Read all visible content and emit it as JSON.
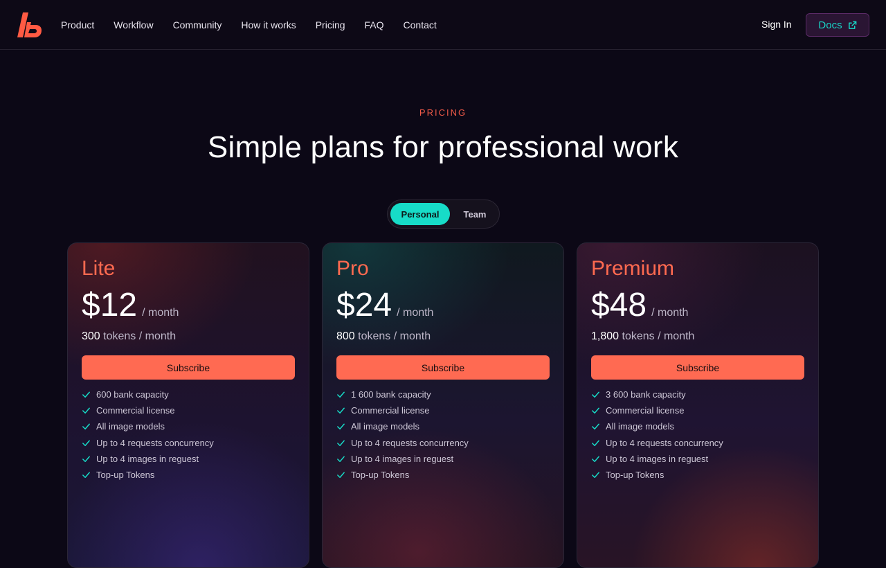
{
  "nav": {
    "links": [
      "Product",
      "Workflow",
      "Community",
      "How it works",
      "Pricing",
      "FAQ",
      "Contact"
    ],
    "sign_in": "Sign In",
    "docs": "Docs"
  },
  "hero": {
    "eyebrow": "PRICING",
    "title": "Simple plans for professional work"
  },
  "toggle": {
    "options": [
      "Personal",
      "Team"
    ],
    "selected": "Personal"
  },
  "plans": [
    {
      "name": "Lite",
      "price": "$12",
      "per": "/ month",
      "tokens": "300",
      "tokens_suffix": "tokens / month",
      "cta": "Subscribe",
      "features": [
        "600 bank capacity",
        "Commercial license",
        "All image models",
        "Up to 4 requests concurrency",
        "Up to 4 images in reguest",
        "Top-up Tokens"
      ]
    },
    {
      "name": "Pro",
      "price": "$24",
      "per": "/ month",
      "tokens": "800",
      "tokens_suffix": "tokens / month",
      "cta": "Subscribe",
      "features": [
        "1 600 bank capacity",
        "Commercial license",
        "All image models",
        "Up to 4 requests concurrency",
        "Up to 4 images in reguest",
        "Top-up Tokens"
      ]
    },
    {
      "name": "Premium",
      "price": "$48",
      "per": "/ month",
      "tokens": "1,800",
      "tokens_suffix": "tokens / month",
      "cta": "Subscribe",
      "features": [
        "3 600 bank capacity",
        "Commercial license",
        "All image models",
        "Up to 4 requests concurrency",
        "Up to 4 images in reguest",
        "Top-up Tokens"
      ]
    }
  ],
  "icons": {
    "logo": "brand-logo-icon",
    "docs": "external-link-icon",
    "feature": "check-icon"
  },
  "colors": {
    "accent_coral": "#ff6a52",
    "accent_teal": "#17dcc8",
    "background": "#0c0816"
  }
}
